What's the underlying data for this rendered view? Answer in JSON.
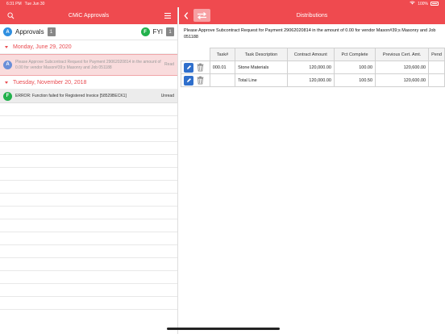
{
  "status_bar": {
    "time": "6:31 PM",
    "date": "Tue Jun 30",
    "battery": "100%"
  },
  "left_pane": {
    "title": "CMiC Approvals",
    "tabs": {
      "approvals": {
        "badge": "A",
        "label": "Approvals",
        "count": "1",
        "color": "#2f8fe0"
      },
      "fyi": {
        "badge": "F",
        "label": "FYI",
        "count": "1",
        "color": "#22b14c"
      }
    },
    "groups": [
      {
        "date": "Monday, June 29, 2020",
        "items": [
          {
            "badge": "A",
            "text": "Please Approve Subcontract Request for Payment 29062020814 in the amount of 0.00 for vendor Mason#39;s Masonry and Job 051188",
            "status": "Read"
          }
        ]
      },
      {
        "date": "Tuesday, November 20, 2018",
        "items": [
          {
            "badge": "F",
            "text": "ERROR: Function failed for Registered Invoice [58529BECK1]",
            "status": "Unread"
          }
        ]
      }
    ]
  },
  "right_pane": {
    "title": "Distributions",
    "subject": "Please Approve Subcontract Request for Payment 29062020814 in the amount of 0.00 for vendor Mason#39;s Masonry and Job 051188",
    "table": {
      "headers": [
        "Task#",
        "Task Description",
        "Contract Amount",
        "Pct Complete",
        "Previous Cert. Amt.",
        "Pend"
      ],
      "rows": [
        [
          "000.01",
          "Stone Materials",
          "120,000.00",
          "100.00",
          "120,600.00",
          ""
        ],
        [
          "",
          "Total Line",
          "120,000.00",
          "100.50",
          "120,600.00",
          ""
        ]
      ]
    }
  },
  "icons": {
    "search": "search-icon",
    "menu": "hamburger-menu-icon",
    "back": "chevron-left-icon",
    "swap": "swap-icon",
    "edit": "pencil-icon",
    "delete": "trash-icon",
    "wifi": "wifi-icon",
    "battery": "battery-icon"
  },
  "colors": {
    "accent": "#ef4a4f",
    "section_text": "#e94b50",
    "edit_button": "#2f6fcc"
  }
}
